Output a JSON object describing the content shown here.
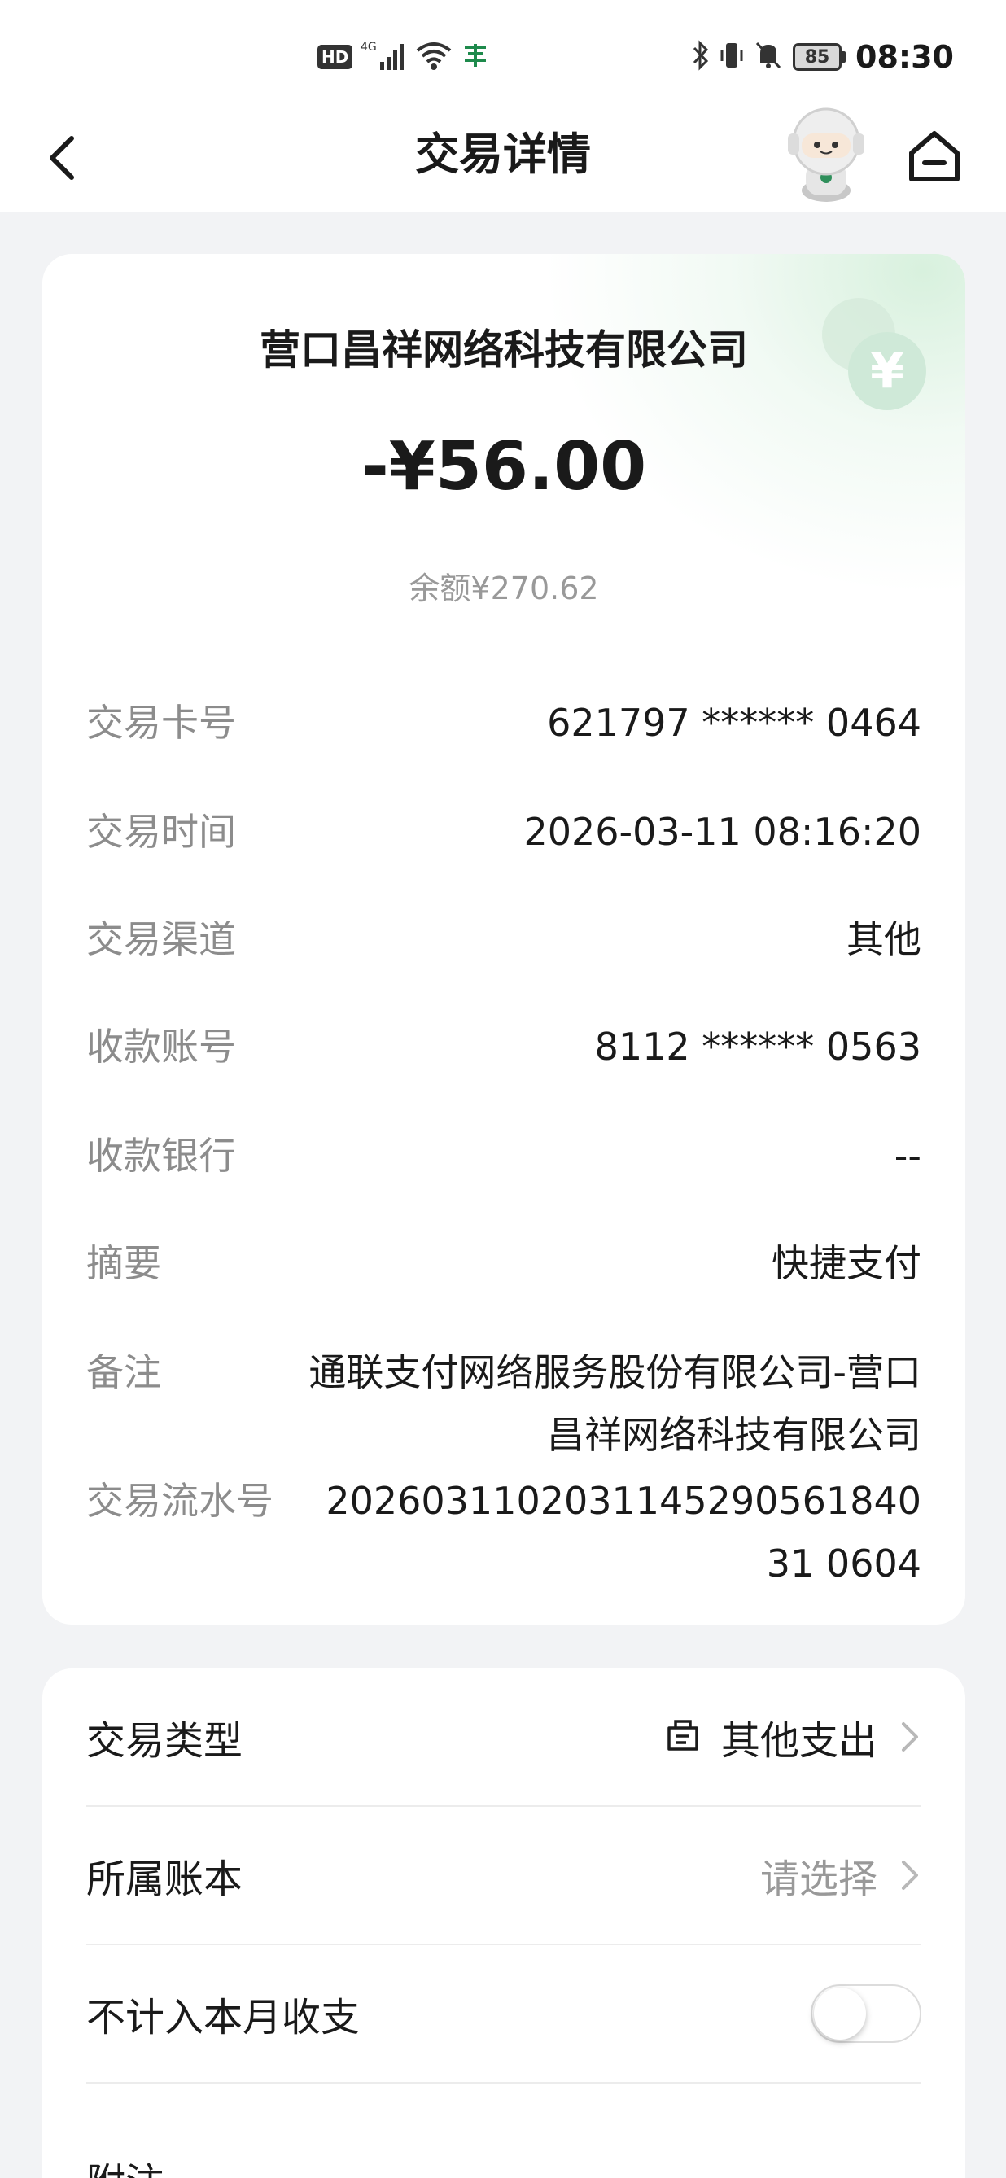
{
  "status_bar": {
    "network_badge": "HD",
    "signal_label": "4G",
    "wifi_label": "6",
    "battery_level": "85",
    "time": "08:30"
  },
  "nav": {
    "title": "交易详情",
    "back_icon": "back-arrow-icon",
    "mascot_icon": "robot-assistant-icon",
    "home_icon": "home-icon"
  },
  "transaction": {
    "merchant": "营口昌祥网络科技有限公司",
    "amount": "-¥56.00",
    "balance": "余额¥270.62",
    "coin_icon": "yuan-coin-icon",
    "details": [
      {
        "label": "交易卡号",
        "value": "621797 ****** 0464"
      },
      {
        "label": "交易时间",
        "value": "2026-03-11 08:16:20"
      },
      {
        "label": "交易渠道",
        "value": "其他"
      },
      {
        "label": "收款账号",
        "value": "8112 ****** 0563"
      },
      {
        "label": "收款银行",
        "value": "--"
      },
      {
        "label": "摘要",
        "value": "快捷支付"
      },
      {
        "label": "备注",
        "value": "通联支付网络服务股份有限公司-营口昌祥网络科技有限公司"
      },
      {
        "label": "交易流水号",
        "value": "202603110203114529056184031 0604"
      }
    ]
  },
  "options": {
    "type_label": "交易类型",
    "type_value": "其他支出",
    "type_icon": "category-icon",
    "ledger_label": "所属账本",
    "ledger_placeholder": "请选择",
    "exclude_label": "不计入本月收支",
    "exclude_enabled": false,
    "attachment_label": "附注"
  },
  "colors": {
    "background": "#f2f3f5",
    "card": "#ffffff",
    "accent_green": "#cfe9d8",
    "label_gray": "#8c8c8c"
  }
}
